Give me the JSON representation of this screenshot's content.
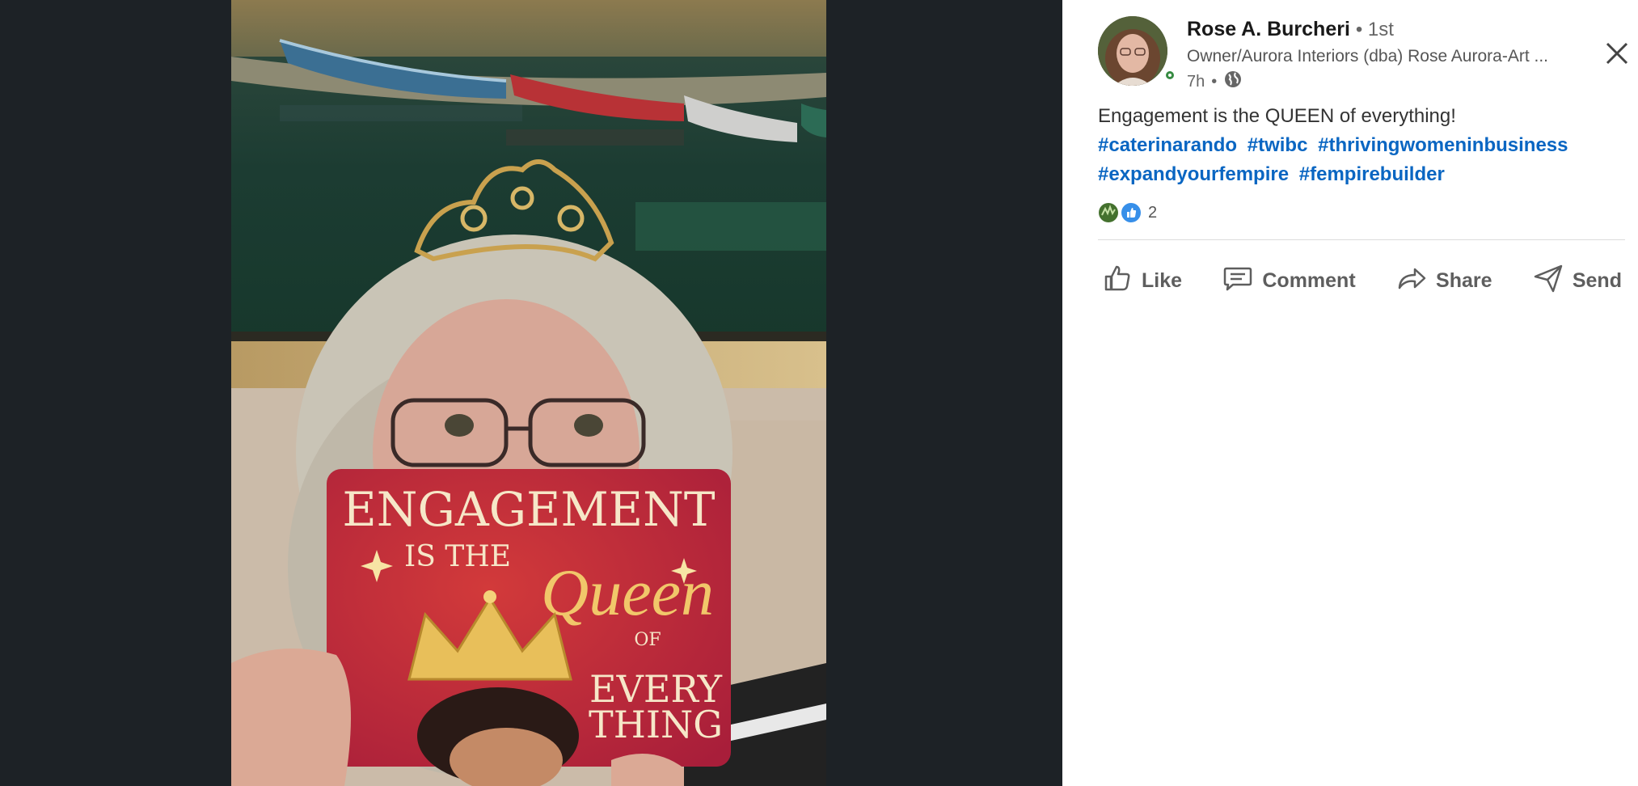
{
  "post": {
    "author_name": "Rose A. Burcheri",
    "connection_degree": "• 1st",
    "headline": "Owner/Aurora Interiors (dba) Rose Aurora-Art ...",
    "time": "7h",
    "time_separator": "•",
    "text": "Engagement is the QUEEN of everything!",
    "hashtags": [
      "#caterinarando",
      "#twibc",
      "#thrivingwomeninbusiness",
      "#expandyourfempire",
      "#fempirebuilder"
    ],
    "reaction_count": "2"
  },
  "actions": {
    "like": "Like",
    "comment": "Comment",
    "share": "Share",
    "send": "Send"
  },
  "photo_card": {
    "line1": "ENGAGEMENT",
    "line2": "IS THE",
    "line3": "Queen",
    "line4": "OF",
    "line5": "EVERY",
    "line6": "THING"
  },
  "icons": {
    "close": "close-icon",
    "globe": "globe-icon",
    "like": "thumbs-up-icon",
    "comment": "comment-icon",
    "share": "share-arrow-icon",
    "send": "send-icon"
  },
  "colors": {
    "media_background": "#1d2226",
    "hashtag": "#0a66c2",
    "presence": "#378b42",
    "like_reaction": "#378fe9",
    "support_reaction": "#44712e"
  }
}
